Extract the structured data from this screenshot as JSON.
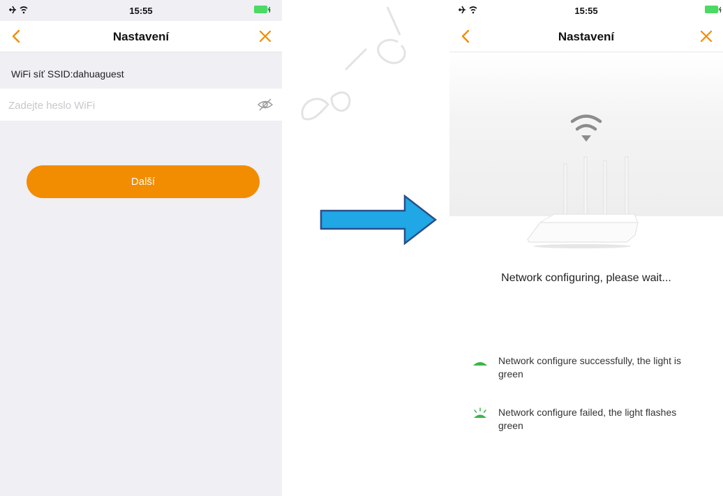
{
  "status_bar": {
    "time": "15:55"
  },
  "left_screen": {
    "nav": {
      "title": "Nastavení"
    },
    "ssid_label": "WiFi síť SSID:dahuaguest",
    "password": {
      "value": "",
      "placeholder": "Zadejte heslo WiFi"
    },
    "next_button_label": "Další"
  },
  "right_screen": {
    "nav": {
      "title": "Nastavení"
    },
    "status_text": "Network configuring, please wait...",
    "legend": [
      {
        "icon": "light-steady-icon",
        "text": "Network configure successfully, the light is green"
      },
      {
        "icon": "light-flashing-icon",
        "text": "Network configure failed, the light flashes green"
      }
    ]
  },
  "colors": {
    "accent": "#f28c00",
    "battery": "#4cd964",
    "light_green": "#3cb44b",
    "arrow_fill": "#1fa7e6",
    "arrow_stroke": "#2a4f8a"
  }
}
